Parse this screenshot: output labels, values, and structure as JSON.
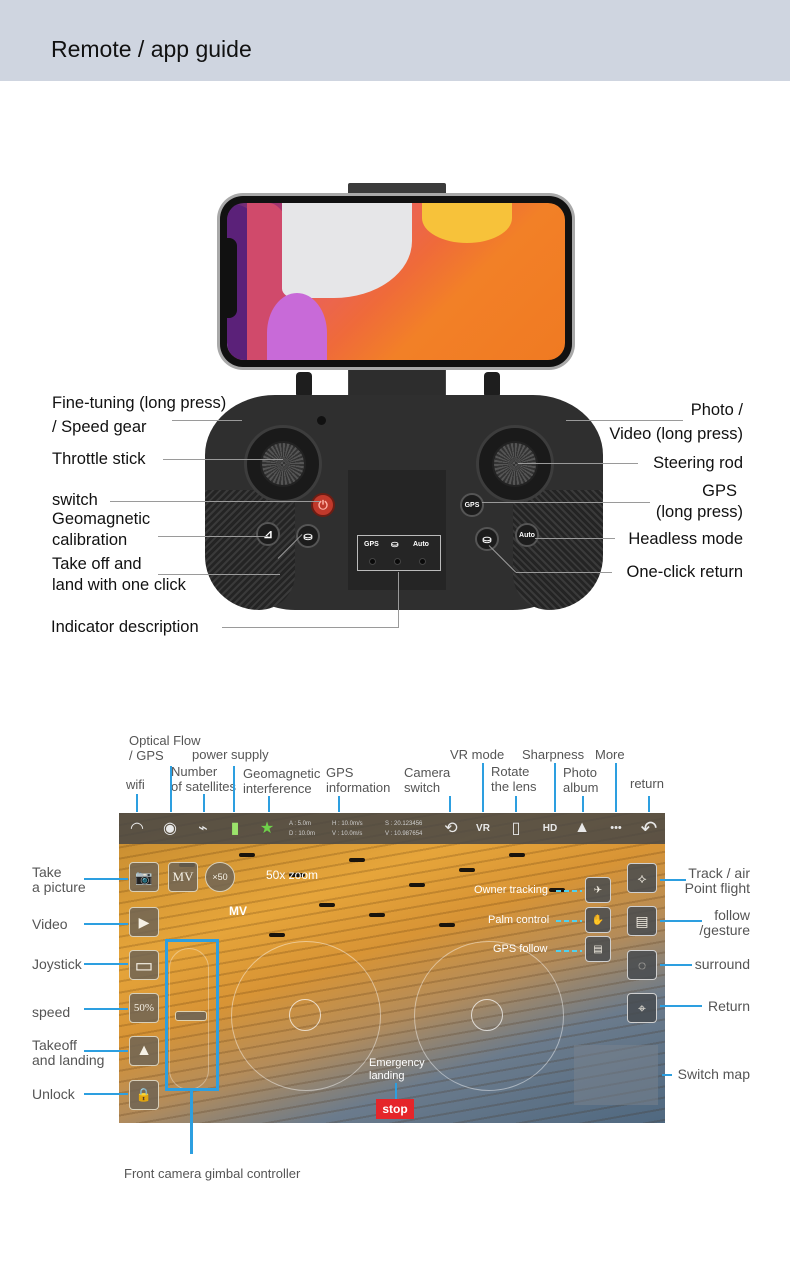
{
  "header": {
    "title": "Remote / app guide"
  },
  "remote": {
    "labels_left": [
      {
        "id": "fine-tuning",
        "lines": [
          "Fine-tuning (long press)",
          "/ Speed gear"
        ]
      },
      {
        "id": "throttle",
        "lines": [
          "Throttle stick"
        ]
      },
      {
        "id": "switch",
        "lines": [
          "switch"
        ]
      },
      {
        "id": "geomagnetic",
        "lines": [
          "Geomagnetic",
          "calibration"
        ]
      },
      {
        "id": "takeoff",
        "lines": [
          "Take off and",
          "land with one click"
        ]
      },
      {
        "id": "indicator",
        "lines": [
          "Indicator description"
        ]
      }
    ],
    "labels_right": [
      {
        "id": "photo",
        "lines": [
          "Photo /",
          "Video (long press)"
        ]
      },
      {
        "id": "steering",
        "lines": [
          "Steering rod"
        ]
      },
      {
        "id": "gps",
        "lines": [
          "GPS",
          "(long press)"
        ]
      },
      {
        "id": "headless",
        "lines": [
          "Headless mode"
        ]
      },
      {
        "id": "return",
        "lines": [
          "One-click return"
        ]
      }
    ],
    "buttons": {
      "gps": "GPS",
      "auto": "Auto",
      "power_icon": "⏻",
      "calib_icon": "⊿",
      "drone_icon": "⛀"
    },
    "indicator_panel": [
      "GPS",
      "⛀",
      "Auto"
    ]
  },
  "app": {
    "top_callouts": {
      "optical_flow": [
        "Optical Flow",
        "/ GPS"
      ],
      "power_supply": "power supply",
      "wifi": "wifi",
      "satellites": [
        "Number",
        "of satellites"
      ],
      "geomagnetic": [
        "Geomagnetic",
        "interference"
      ],
      "gps_info": [
        "GPS",
        "information"
      ],
      "camera_switch": [
        "Camera",
        "switch"
      ],
      "vr_mode": "VR mode",
      "rotate_lens": [
        "Rotate",
        "the lens"
      ],
      "sharpness": "Sharpness",
      "photo_album": [
        "Photo",
        "album"
      ],
      "more": "More",
      "return": "return"
    },
    "topbar_icons": {
      "wifi": "◠",
      "optical_flow": "◉",
      "satellite": "⌁",
      "battery": "▮",
      "geomagnetic": "★",
      "camera_switch": "⟲",
      "vr": "VR",
      "rotate": "▯",
      "hd": "HD",
      "album": "▲",
      "more": "•••",
      "return": "↶"
    },
    "gps_info": {
      "A": "A : 5.0m",
      "D": "D : 10.0m",
      "H": "H : 10.0m/s",
      "V_speed": "V : 10.0m/s",
      "S": "S : 20.123456",
      "V_coord": "V : 10.987654"
    },
    "left_callouts": [
      {
        "id": "take-picture",
        "lines": [
          "Take",
          "a picture"
        ]
      },
      {
        "id": "video",
        "lines": [
          "Video"
        ]
      },
      {
        "id": "joystick",
        "lines": [
          "Joystick"
        ]
      },
      {
        "id": "speed",
        "lines": [
          "speed"
        ]
      },
      {
        "id": "takeoff-landing",
        "lines": [
          "Takeoff",
          "and landing"
        ]
      },
      {
        "id": "unlock",
        "lines": [
          "Unlock"
        ]
      }
    ],
    "left_tiles": {
      "camera": "📷",
      "mv": "MV",
      "zoom": "×50",
      "video": "▶",
      "joystick": "▭",
      "speed": "50%",
      "takeoff": "▲",
      "unlock": "🔒"
    },
    "inline_callouts": {
      "zoom": "50x zoom",
      "mv": "MV"
    },
    "right_inner_callouts": [
      "Owner tracking",
      "Palm control",
      "GPS follow"
    ],
    "right_callouts": [
      {
        "id": "track",
        "lines": [
          "Track / air",
          "Point flight"
        ]
      },
      {
        "id": "follow",
        "lines": [
          "follow",
          "/gesture"
        ]
      },
      {
        "id": "surround",
        "lines": [
          "surround"
        ]
      },
      {
        "id": "return",
        "lines": [
          "Return"
        ]
      },
      {
        "id": "switch-map",
        "lines": [
          "Switch map"
        ]
      }
    ],
    "emergency": {
      "label": [
        "Emergency",
        "landing"
      ],
      "button": "stop"
    },
    "gimbal_label": "Front camera gimbal controller"
  },
  "colors": {
    "header_bg": "#cfd5e0",
    "callout_line": "#2d9fe0",
    "stop": "#e5252a"
  }
}
